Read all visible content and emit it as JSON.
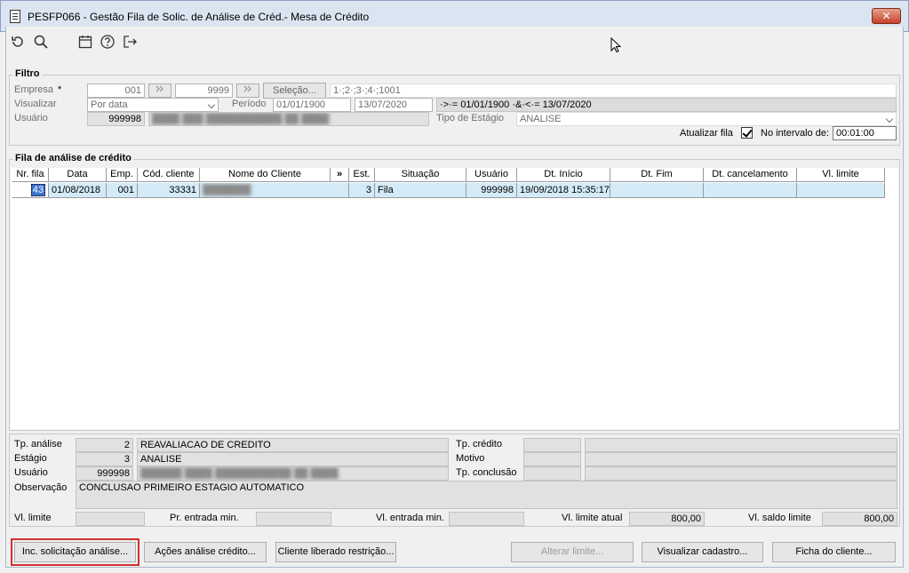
{
  "window": {
    "title": "PESFP066 - Gestão Fila de Solic. de Análise de Créd.- Mesa de Crédito",
    "close_label": "✕"
  },
  "toolbar": {
    "icons": [
      "refresh-icon",
      "search-icon",
      "calendar-icon",
      "help-icon",
      "exit-icon"
    ]
  },
  "filter": {
    "title": "Filtro",
    "empresa_label": "Empresa",
    "required_mark": "*",
    "empresa_from": "001",
    "empresa_to": "9999",
    "selecao_label": "Seleção...",
    "empresa_list": "1·;2·;3·;4·;1001",
    "visualizar_label": "Visualizar",
    "visualizar_value": "Por data",
    "periodo_label": "Período",
    "periodo_from": "01/01/1900",
    "periodo_to": "13/07/2020",
    "periodo_expr": "·>·= 01/01/1900 ·&·<·= 13/07/2020",
    "usuario_label": "Usuário",
    "usuario_code": "999998",
    "usuario_name": "████ ███ ███████████ ██ ████",
    "tipo_estagio_label": "Tipo de Estágio",
    "tipo_estagio_value": "ANALISE",
    "atualizar_label": "Atualizar fila",
    "intervalo_label": "No intervalo de:",
    "intervalo_value": "00:01:00"
  },
  "queue": {
    "title": "Fila de análise de crédito",
    "columns": [
      "Nr. fila",
      "Data",
      "Emp.",
      "Cód. cliente",
      "Nome do Cliente",
      "»",
      "Est.",
      "Situação",
      "Usuário",
      "Dt. Início",
      "Dt. Fim",
      "Dt. cancelamento",
      "Vl. limite"
    ],
    "rows": [
      {
        "nr": "43",
        "data": "01/08/2018",
        "emp": "001",
        "cod": "33331",
        "nome": "███████",
        "est": "3",
        "situacao": "Fila",
        "usuario": "999998",
        "inicio": "19/09/2018 15:35:17",
        "fim": "",
        "cancel": "",
        "limite": ""
      }
    ]
  },
  "detail": {
    "tp_analise_label": "Tp. análise",
    "tp_analise_code": "2",
    "tp_analise_desc": "REAVALIACAO DE CREDITO",
    "estagio_label": "Estágio",
    "estagio_code": "3",
    "estagio_desc": "ANALISE",
    "usuario_label": "Usuário",
    "usuario_code": "999998",
    "usuario_name": "██████ ████ ███████████ ██ ████",
    "tp_credito_label": "Tp. crédito",
    "motivo_label": "Motivo",
    "tp_conclusao_label": "Tp. conclusão",
    "observacao_label": "Observação",
    "observacao_value": "CONCLUSAO PRIMEIRO ESTAGIO AUTOMATICO",
    "vl_limite_label": "Vl. limite",
    "pr_entrada_label": "Pr. entrada min.",
    "vl_entrada_label": "Vl. entrada min.",
    "vl_limite_atual_label": "Vl. limite atual",
    "vl_limite_atual_value": "800,00",
    "vl_saldo_label": "Vl. saldo limite",
    "vl_saldo_value": "800,00"
  },
  "buttons": {
    "inc": "Inc. solicitação análise...",
    "acoes": "Ações análise crédito...",
    "liberado": "Cliente liberado restrição...",
    "alterar": "Alterar limite...",
    "visualizar": "Visualizar cadastro...",
    "ficha": "Ficha do cliente..."
  }
}
